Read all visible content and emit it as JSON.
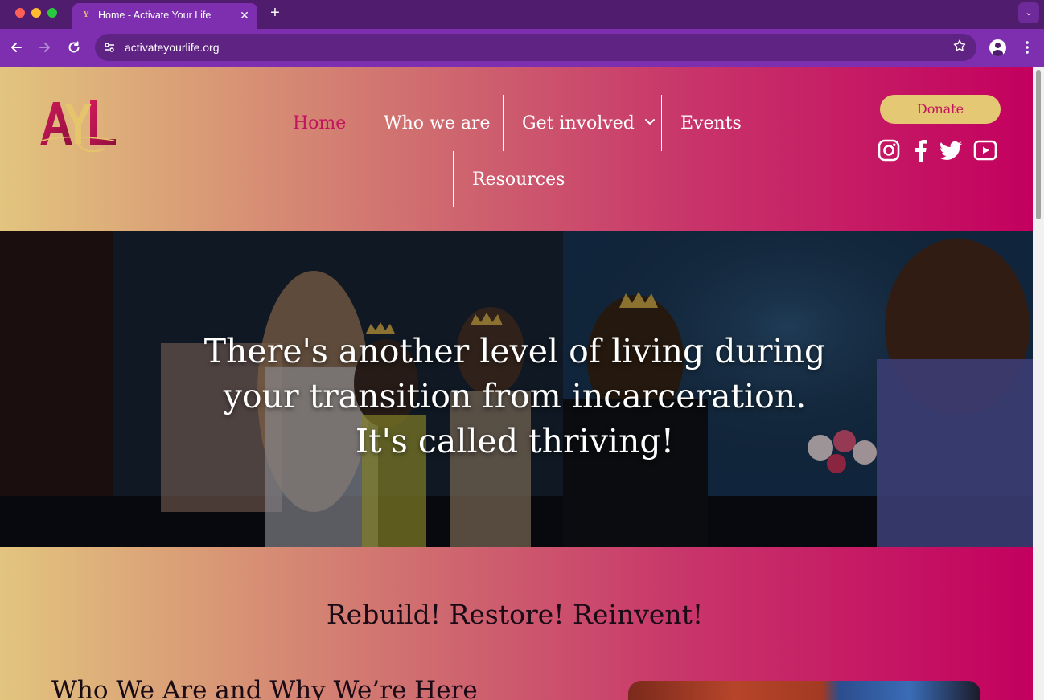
{
  "browser": {
    "tab": {
      "title": "Home - Activate Your Life",
      "favicon": "Y"
    },
    "close_glyph": "✕",
    "new_tab_glyph": "+",
    "tab_menu_glyph": "⌄",
    "url": "activateyourlife.org",
    "icons": [
      "back-arrow-icon",
      "forward-arrow-icon",
      "reload-icon",
      "site-info-icon",
      "bookmark-star-icon",
      "profile-icon",
      "more-menu-icon"
    ]
  },
  "header": {
    "logo_alt": "Activate Your Life",
    "nav": {
      "home": "Home",
      "who": "Who we are",
      "get_involved": "Get involved",
      "events": "Events",
      "resources": "Resources"
    },
    "active_nav": "Home",
    "donate_label": "Donate",
    "social": [
      "instagram-icon",
      "facebook-icon",
      "twitter-icon",
      "youtube-icon"
    ]
  },
  "hero": {
    "lines": [
      "There's another level of living during",
      "your transition from incarceration.",
      "It's called thriving!"
    ]
  },
  "section": {
    "tagline": "Rebuild! Restore! Reinvent!",
    "heading": "Who We Are and Why We’re Here"
  },
  "colors": {
    "brand_pink": "#c2135e",
    "brand_gold": "#e4c873",
    "chrome_purple": "#7e2fb0"
  }
}
